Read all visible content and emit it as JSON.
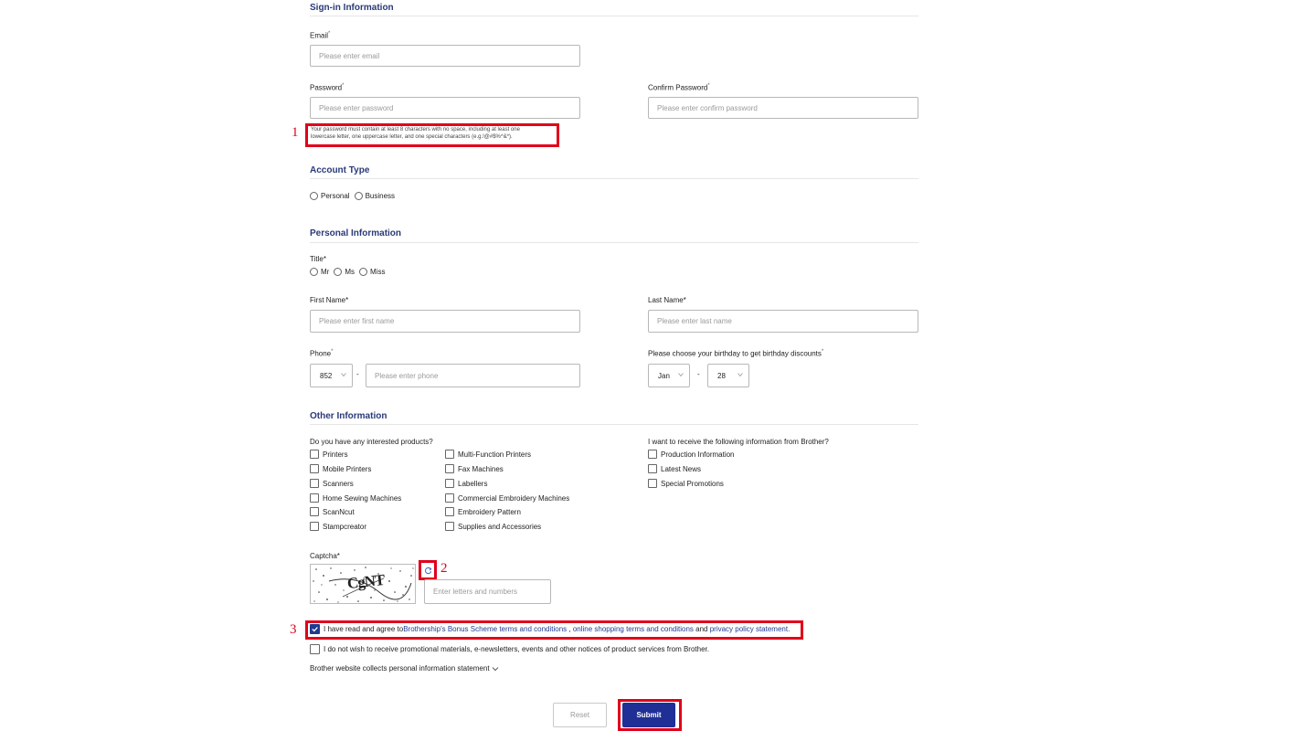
{
  "sections": {
    "signin": "Sign-in Information",
    "account_type": "Account Type",
    "personal": "Personal Information",
    "other": "Other Information"
  },
  "signin": {
    "email_label": "Email",
    "email_placeholder": "Please enter email",
    "password_label": "Password",
    "password_placeholder": "Please enter password",
    "confirm_label": "Confirm Password",
    "confirm_placeholder": "Please enter confirm password",
    "password_hint_line1": "Your password must contain at least 8 characters with no space, including at least one",
    "password_hint_line2": "lowercase letter, one uppercase letter, and one special characters (e.g.!@#$%^&*)."
  },
  "account_type": {
    "options": [
      "Personal",
      "Business"
    ]
  },
  "personal": {
    "title_label": "Title*",
    "title_options": [
      "Mr",
      "Ms",
      "Miss"
    ],
    "first_name_label": "First Name*",
    "first_name_placeholder": "Please enter first name",
    "last_name_label": "Last Name*",
    "last_name_placeholder": "Please enter last name",
    "phone_label": "Phone",
    "phone_code": "852",
    "phone_placeholder": "Please enter phone",
    "dash": "-",
    "birthday_label": "Please choose your birthday to get birthday discounts",
    "birth_month": "Jan",
    "birth_day": "28"
  },
  "other": {
    "products_label": "Do you have any interested products?",
    "products_col1": [
      "Printers",
      "Mobile Printers",
      "Scanners",
      "Home Sewing Machines",
      "ScanNcut",
      "Stampcreator"
    ],
    "products_col2": [
      "Multi-Function Printers",
      "Fax Machines",
      "Labellers",
      "Commercial Embroidery Machines",
      "Embroidery Pattern",
      "Supplies and Accessories"
    ],
    "info_label": "I want to receive the following information from Brother?",
    "info_options": [
      "Production Information",
      "Latest News",
      "Special Promotions"
    ]
  },
  "captcha": {
    "label": "Captcha*",
    "image_text": "CgNT",
    "placeholder": "Enter letters and numbers"
  },
  "agreements": {
    "agree_prefix": "I have read and agree to ",
    "agree_link1": "Brothership's Bonus Scheme terms and conditions",
    "agree_sep1": " , ",
    "agree_link2": "online shopping terms and conditions",
    "agree_sep2": " and ",
    "agree_link3": "privacy policy statement.",
    "no_promo": "I do not wish to receive promotional materials, e-newsletters, events and other notices of product services from Brother.",
    "collects_statement": "Brother website collects personal information statement"
  },
  "buttons": {
    "reset": "Reset",
    "submit": "Submit"
  },
  "annotations": [
    "1",
    "2",
    "3"
  ],
  "colors": {
    "heading": "#2a3a78",
    "link": "#1f3b8f",
    "submit_bg": "#1f2f96",
    "annotation_red": "#e0001b"
  }
}
